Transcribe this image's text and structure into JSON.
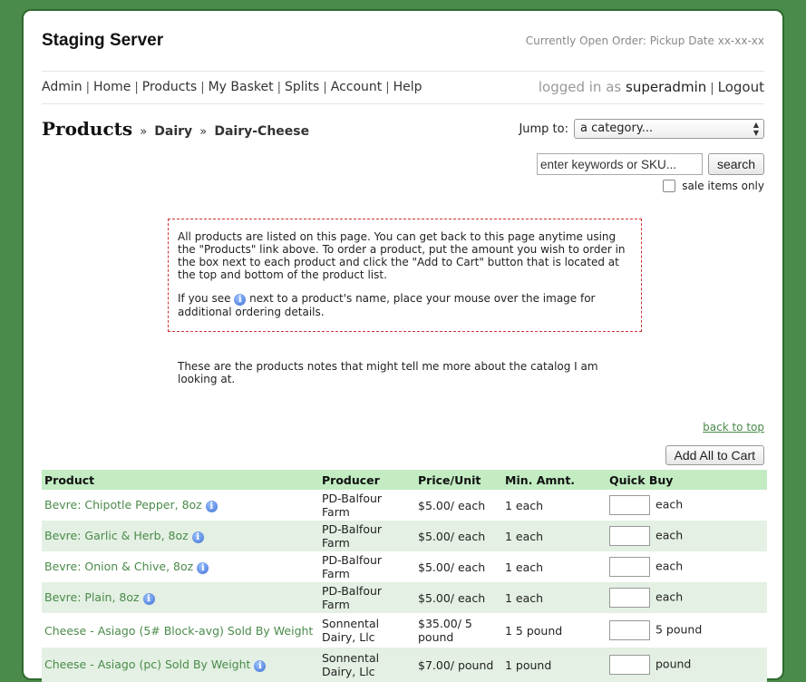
{
  "header": {
    "site_title": "Staging Server",
    "open_order": "Currently Open Order: Pickup Date xx-xx-xx"
  },
  "nav": {
    "items": [
      "Admin",
      "Home",
      "Products",
      "My Basket",
      "Splits",
      "Account",
      "Help"
    ],
    "separator": "|"
  },
  "login": {
    "prefix": "logged in as",
    "user": "superadmin",
    "logout": "Logout"
  },
  "breadcrumb": {
    "title": "Products",
    "arrow": "»",
    "category": "Dairy",
    "subcategory": "Dairy-Cheese"
  },
  "jump": {
    "label": "Jump to:",
    "selected": "a category..."
  },
  "search": {
    "placeholder": "enter keywords or SKU...",
    "button": "search",
    "sale_label": "sale items only"
  },
  "notice": {
    "paragraph1": "All products are listed on this page. You can get back to this page anytime using the \"Products\" link above. To order a product, put the amount you wish to order in the box next to each product and click the \"Add to Cart\" button that is located at the top and bottom of the product list.",
    "paragraph2_before": "If you see",
    "paragraph2_after": "next to a product's name, place your mouse over the image for additional ordering details."
  },
  "catalog_notes": "These are the products notes that might tell me more about the catalog I am looking at.",
  "back_to_top": "back to top",
  "add_all_button": "Add All to Cart",
  "table": {
    "headers": [
      "Product",
      "Producer",
      "Price/Unit",
      "Min. Amnt.",
      "Quick Buy"
    ],
    "rows": [
      {
        "product": "Bevre: Chipotle Pepper, 8oz",
        "info": true,
        "producer": "PD-Balfour Farm",
        "price": "$5.00/ each",
        "min": "1 each",
        "unit": "each"
      },
      {
        "product": "Bevre: Garlic & Herb, 8oz",
        "info": true,
        "producer": "PD-Balfour Farm",
        "price": "$5.00/ each",
        "min": "1 each",
        "unit": "each"
      },
      {
        "product": "Bevre: Onion & Chive, 8oz",
        "info": true,
        "producer": "PD-Balfour Farm",
        "price": "$5.00/ each",
        "min": "1 each",
        "unit": "each"
      },
      {
        "product": "Bevre: Plain, 8oz",
        "info": true,
        "producer": "PD-Balfour Farm",
        "price": "$5.00/ each",
        "min": "1 each",
        "unit": "each"
      },
      {
        "product": "Cheese - Asiago (5# Block-avg) Sold By Weight",
        "info": false,
        "producer": "Sonnental Dairy, Llc",
        "price": "$35.00/ 5 pound",
        "min": "1 5 pound",
        "unit": "5 pound"
      },
      {
        "product": "Cheese - Asiago (pc) Sold By Weight",
        "info": true,
        "producer": "Sonnental Dairy, Llc",
        "price": "$7.00/ pound",
        "min": "1 pound",
        "unit": "pound"
      }
    ]
  },
  "colors": {
    "page_bg": "#4a8a4a",
    "header_row": "#c3ecc3",
    "alt_row": "#e3f0e3",
    "link_green": "#4a8a4a",
    "notice_border": "#cc3333"
  },
  "icons": {
    "info": "info-icon",
    "dropdown": "chevron-updown-icon"
  }
}
